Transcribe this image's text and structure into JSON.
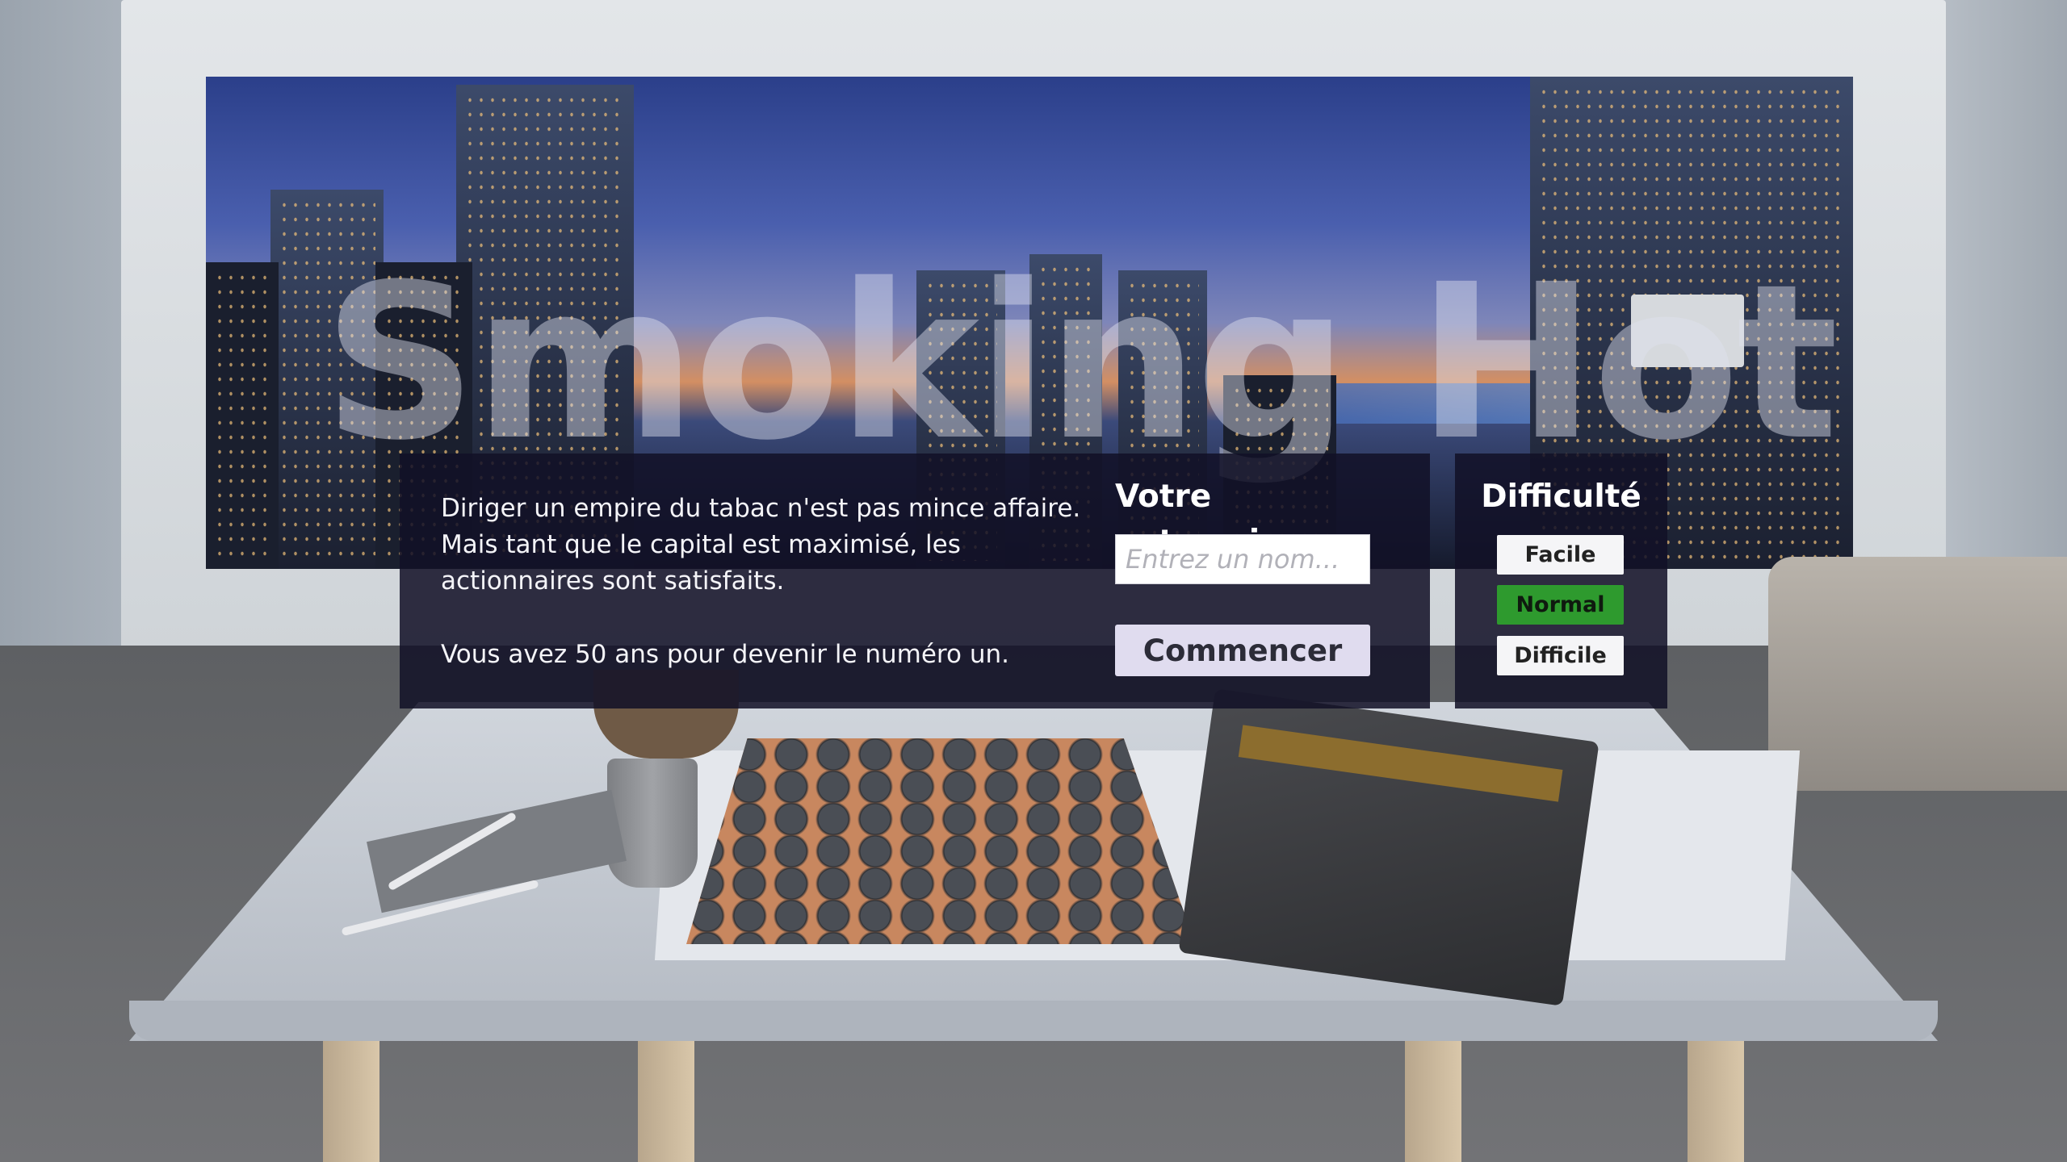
{
  "game": {
    "logo_text": "Smoking Hot"
  },
  "intro": {
    "paragraph_1": "Diriger un empire du tabac n'est pas mince affaire. Mais tant que le capital est maximisé, les actionnaires sont satisfaits.",
    "paragraph_2": "Vous avez 50 ans pour devenir le numéro un."
  },
  "company": {
    "heading": "Votre entreprise",
    "name_value": "",
    "name_placeholder": "Entrez un nom...",
    "start_label": "Commencer"
  },
  "difficulty": {
    "heading": "Difficulté",
    "options": [
      "Facile",
      "Normal",
      "Difficile"
    ],
    "selected": "Normal",
    "selected_color": "#2e9a2e"
  }
}
